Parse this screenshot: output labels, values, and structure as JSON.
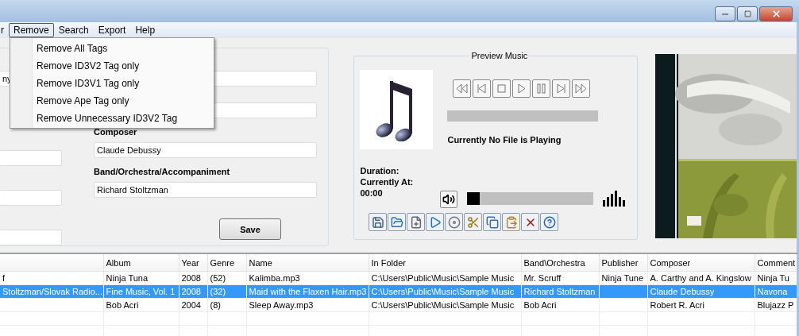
{
  "menu": [
    {
      "label": "r",
      "selected": false
    },
    {
      "label": "Remove",
      "selected": true
    },
    {
      "label": "Search",
      "selected": false
    },
    {
      "label": "Export",
      "selected": false
    },
    {
      "label": "Help",
      "selected": false
    }
  ],
  "dropdown": [
    "Remove All Tags",
    "Remove ID3V2 Tag only",
    "Remove ID3V1 Tag only",
    "Remove Ape Tag only",
    "Remove Unnecessary ID3V2 Tag"
  ],
  "left_fields": [
    {
      "value": "ny"
    }
  ],
  "right_fields": [
    {
      "label": "Composer",
      "value": "Claude Debussy"
    },
    {
      "label": "Band/Orchestra/Accompaniment",
      "value": "Richard Stoltzman"
    }
  ],
  "save_button": "Save",
  "preview": {
    "title": "Preview Music",
    "status": "Currently No File is Playing",
    "duration_label": "Duration:",
    "position_label": "Currently At:",
    "position": "00:00",
    "volume": {
      "level": 0.1
    }
  },
  "table": {
    "columns": [
      null,
      "Album",
      "Year",
      "Genre",
      "Name",
      "In Folder",
      "Band\\Orchestra",
      "Publisher",
      "Composer",
      "Comment"
    ],
    "rows": [
      {
        "selected": false,
        "cells": [
          "f",
          "Ninja Tuna",
          "2008",
          "(52)",
          "Kalimba.mp3",
          "C:\\Users\\Public\\Music\\Sample Music",
          "Mr. Scruff",
          "Ninja Tune",
          "A. Carthy and A. Kingslow",
          "Ninja Tu"
        ]
      },
      {
        "selected": true,
        "cells": [
          "Stoltzman/Slovak Radio...",
          "Fine Music, Vol. 1",
          "2008",
          "(32)",
          "Maid with the Flaxen Hair.mp3",
          "C:\\Users\\Public\\Music\\Sample Music",
          "Richard Stoltzman",
          null,
          "Claude Debussy",
          "Navona"
        ]
      },
      {
        "selected": false,
        "cells": [
          null,
          "Bob Acri",
          "2004",
          "(8)",
          "Sleep Away.mp3",
          "C:\\Users\\Public\\Music\\Sample Music",
          "Bob Acri",
          null,
          "Robert R. Acri",
          "Blujazz P"
        ]
      }
    ]
  }
}
